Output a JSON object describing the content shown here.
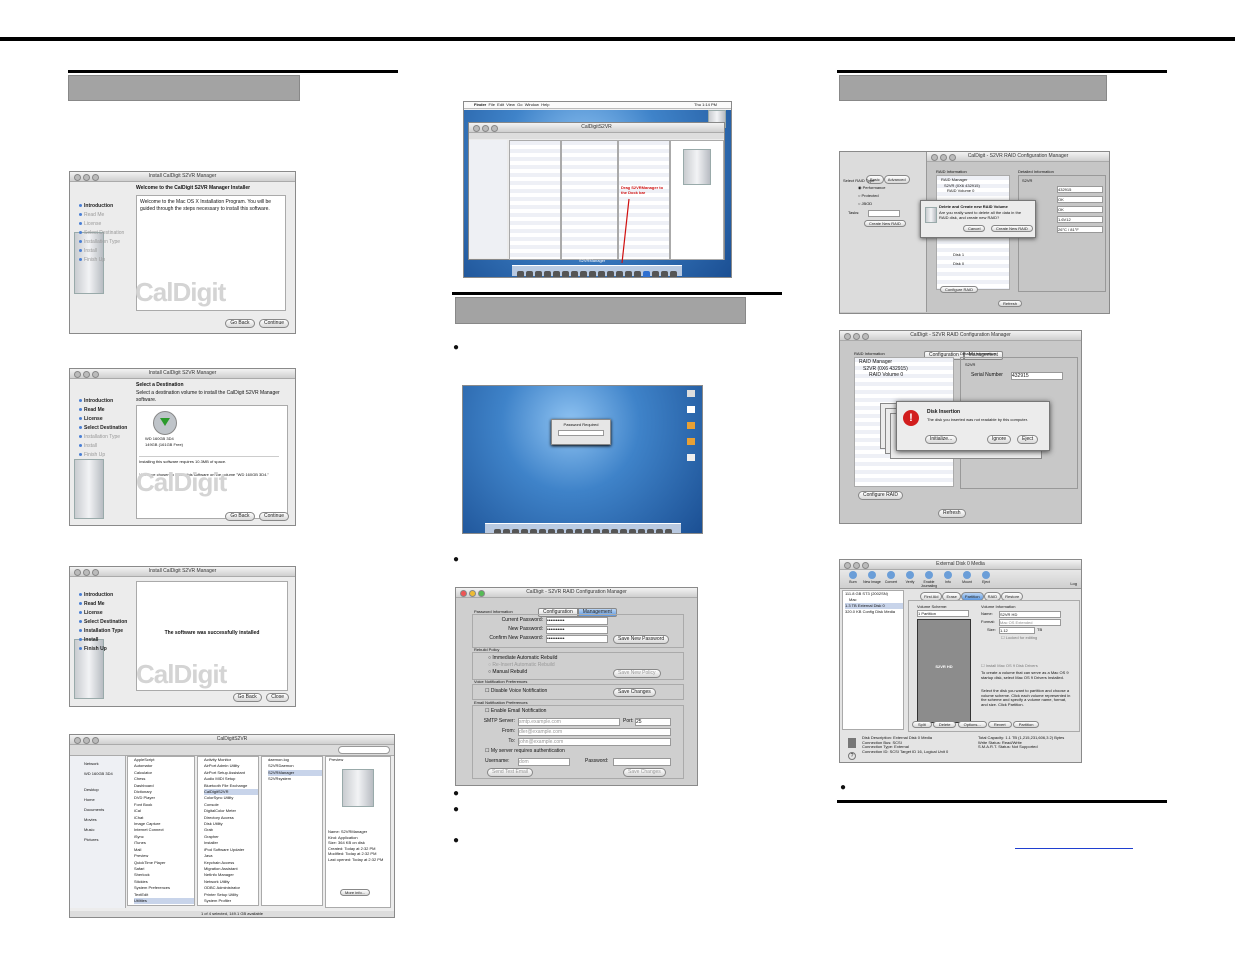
{
  "installer": {
    "title": "Install CalDigit S2VR Manager",
    "welcome_heading": "Welcome to the CalDigit S2VR Manager Installer",
    "welcome_text": "Welcome to the Mac OS X Installation Program. You will be guided through the steps necessary to install this software.",
    "steps": [
      "Introduction",
      "Read Me",
      "License",
      "Select Destination",
      "Installation Type",
      "Install",
      "Finish Up"
    ],
    "destination_heading": "Select a Destination",
    "destination_text": "Select a destination volume to install the CalDigit S2VR Manager software.",
    "volume_name": "WD 160GB 3D4",
    "volume_free": "149GB (161GB Free)",
    "requires_text": "Installing this software requires 10.3MB of space.",
    "chosen_text": "You have chosen to install this software on the volume \"WD 160GB 3D4.\"",
    "success_text": "The software was successfully installed",
    "go_back": "Go Back",
    "continue": "Continue",
    "close": "Close",
    "watermark": "CalDigit"
  },
  "finder": {
    "title": "CalDigitS2VR",
    "sidebar": [
      "Network",
      "WD 160GB 3D4",
      "Desktop",
      "Home",
      "Documents",
      "Movies",
      "Music",
      "Pictures"
    ],
    "col1": [
      "AppleScript",
      "Automator",
      "Calculator",
      "Chess",
      "Dashboard",
      "Dictionary",
      "DVD Player",
      "Font Book",
      "iCal",
      "iChat",
      "Image Capture",
      "Internet Connect",
      "iSync",
      "iTunes",
      "Mail",
      "Preview",
      "QuickTime Player",
      "Safari",
      "Sherlock",
      "Stickies",
      "System Preferences",
      "TextEdit",
      "Utilities"
    ],
    "col2": [
      "Activity Monitor",
      "AirPort Admin Utility",
      "AirPort Setup Assistant",
      "Audio MIDI Setup",
      "Bluetooth File Exchange",
      "CalDigitS2VR",
      "ColorSync Utility",
      "Console",
      "DigitalColor Meter",
      "Directory Access",
      "Disk Utility",
      "Grab",
      "Grapher",
      "Installer",
      "iPod Software Updater",
      "Java",
      "Keychain Access",
      "Migration Assistant",
      "NetInfo Manager",
      "Network Utility",
      "ODBC Administrator",
      "Printer Setup Utility",
      "System Profiler"
    ],
    "col3": [
      "daemon.log",
      "S2VRDaemon",
      "S2VRManager",
      "S2VRsystem"
    ],
    "preview_label": "Preview",
    "info": [
      "Name: S2VRManager",
      "Kind: Application",
      "Size: 364 KB on disk",
      "Created: Today at 2:32 PM",
      "Modified: Today at 2:32 PM",
      "Last opened: Today at 2:32 PM"
    ],
    "more_info": "More info...",
    "status": "1 of 4 selected, 149.1 GB available"
  },
  "desktop1": {
    "menu": [
      "Finder",
      "File",
      "Edit",
      "View",
      "Go",
      "Window",
      "Help"
    ],
    "annotation": "Drag S2VRManager to the Dock bar",
    "dock_label": "S2VRManager",
    "clock": "Thu 1:14 PM"
  },
  "desktop2": {
    "dialog": "Password Required"
  },
  "config": {
    "title": "CalDigit - S2VR RAID Configuration Manager",
    "tabs": [
      "Configuration",
      "Management"
    ],
    "password_section": "Password Information",
    "current_password": "Current Password:",
    "new_password": "New Password:",
    "confirm_password": "Confirm New Password:",
    "password_mask": "••••••••••",
    "save_password": "Save New Password",
    "rebuild_section": "Rebuild Policy",
    "rebuild_opts": [
      "Immediate Automatic Rebuild",
      "Re-Insert Automatic Rebuild",
      "Manual Rebuild"
    ],
    "save_policy": "Save New Policy",
    "voice_section": "Voice Notification Preferences",
    "disable_voice": "Disable Voice Notification",
    "save_changes": "Save Changes",
    "email_section": "Email Notification Preferences",
    "enable_email": "Enable Email Notification",
    "smtp": "SMTP Server:",
    "smtp_val": "smtp.example.com",
    "port": "Port:",
    "port_val": "25",
    "from": "From:",
    "from_val": "dler@example.com",
    "to": "To:",
    "to_val": "john@example.com",
    "auth": "My server requires authentication",
    "username": "Username:",
    "username_val": "dom",
    "password": "Password:",
    "send_test": "Send Test Email"
  },
  "raid1": {
    "title": "CalDigit - S2VR RAID Configuration Manager",
    "left_tabs": [
      "Basic",
      "Advanced"
    ],
    "raid_type": "Select RAID Type",
    "options": [
      "Performance",
      "Protected",
      "JBOD"
    ],
    "tasks": "Tasks:",
    "create_new": "Create New RAID",
    "raid_info": "RAID Information",
    "tree": [
      "RAID Manager",
      "S2VR (0X6 432915)",
      "RAID Volume 0",
      "Disk 0",
      "Disk 1"
    ],
    "detailed": "Detailed Information",
    "detail_rows": [
      "S2VR",
      "Serial Number",
      "Capacity",
      "Status",
      "Temp",
      "FW"
    ],
    "detail_vals": [
      "",
      "432915",
      "OK",
      "OK",
      "1.6V12",
      "26°C / 81°F"
    ],
    "dialog_title": "Delete and Create new RAID Volume",
    "dialog_text": "Are you really want to delete all the data in the RAID disk, and create new RAID?",
    "cancel": "Cancel",
    "create": "Create New RAID",
    "configure": "Configure RAID",
    "refresh": "Refresh"
  },
  "raid2": {
    "title": "CalDigit - S2VR RAID Configuration Manager",
    "tabs": [
      "Configuration",
      "Management"
    ],
    "raid_info": "RAID Information",
    "tree": [
      "RAID Manager",
      "S2VR (0X6 432915)",
      "RAID Volume 0"
    ],
    "detailed": "Detailed Information",
    "s2vr": "S2VR",
    "serial": "Serial Number",
    "serial_val": "432915",
    "dialog_title": "Disk Insertion",
    "dialog_text": "The disk you inserted was not readable by this computer.",
    "initialize": "Initialize...",
    "ignore": "Ignore",
    "eject": "Eject",
    "configure": "Configure RAID",
    "refresh": "Refresh"
  },
  "diskutil": {
    "title": "External Disk 0 Media",
    "toolbar": [
      "Burn",
      "New Image",
      "Convert",
      "Verify",
      "Enable Journaling",
      "Info",
      "Mount",
      "Eject"
    ],
    "log": "Log",
    "disks": [
      "111.8 GB ST3 (2002SN)",
      "Mac",
      "1.3 TB External Disk 0",
      "320.0 KB Config Disk Media"
    ],
    "tabs": [
      "First Aid",
      "Erase",
      "Partition",
      "RAID",
      "Restore"
    ],
    "scheme_label": "Volume Scheme:",
    "scheme_val": "1 Partition",
    "info_label": "Volume Information",
    "name_label": "Name:",
    "name_val": "S2VR HD",
    "format_label": "Format:",
    "format_val": "Mac OS Extended",
    "size_label": "Size:",
    "size_val": "1.12",
    "size_unit": "TB",
    "locked": "Locked for editing",
    "partition_name": "S2VR HD",
    "install_drivers": "Install Mac OS 9 Disk Drivers",
    "help_text1": "To create a volume that can serve as a Mac OS 9 startup disk, select Mac OS 9 Drivers Installed.",
    "help_text2": "Select the disk you want to partition and choose a volume scheme. Click each volume represented in the scheme and specify a volume name, format, and size. Click Partition.",
    "buttons": [
      "Split",
      "Delete",
      "Options...",
      "Revert",
      "Partition"
    ],
    "desc": "Disk Description: External Disk 0 Media",
    "bus": "Connection Bus: SCSI",
    "type": "Connection Type: External",
    "conn_id": "Connection ID: SCSI Target ID 16, Logical Unit 0",
    "capacity": "Total Capacity: 1.1 TB (1,215,231,606,3 2) Bytes",
    "write": "Write Status: Read/Write",
    "smart": "S.M.A.R.T. Status: Not Supported"
  }
}
